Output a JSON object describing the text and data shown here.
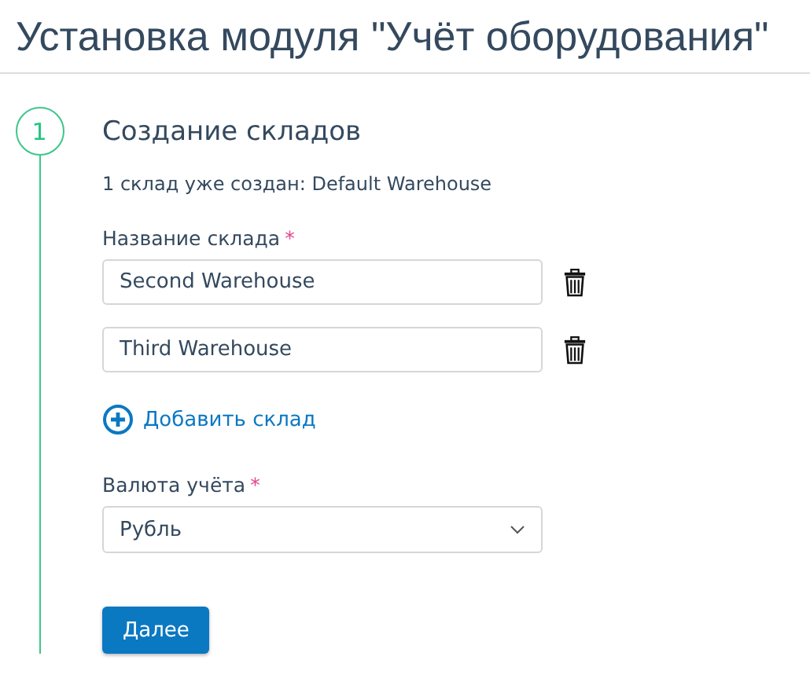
{
  "page_title": "Установка модуля \"Учёт оборудования\"",
  "step": {
    "number": "1",
    "title": "Создание складов",
    "info": "1 склад уже создан:  Default Warehouse",
    "warehouse_field": {
      "label": "Название склада",
      "required_mark": "*"
    },
    "warehouses": [
      {
        "value": "Second Warehouse"
      },
      {
        "value": "Third Warehouse"
      }
    ],
    "add_link": "Добавить склад",
    "currency_field": {
      "label": "Валюта учёта",
      "required_mark": "*",
      "value": "Рубль"
    },
    "next_button": "Далее"
  }
}
